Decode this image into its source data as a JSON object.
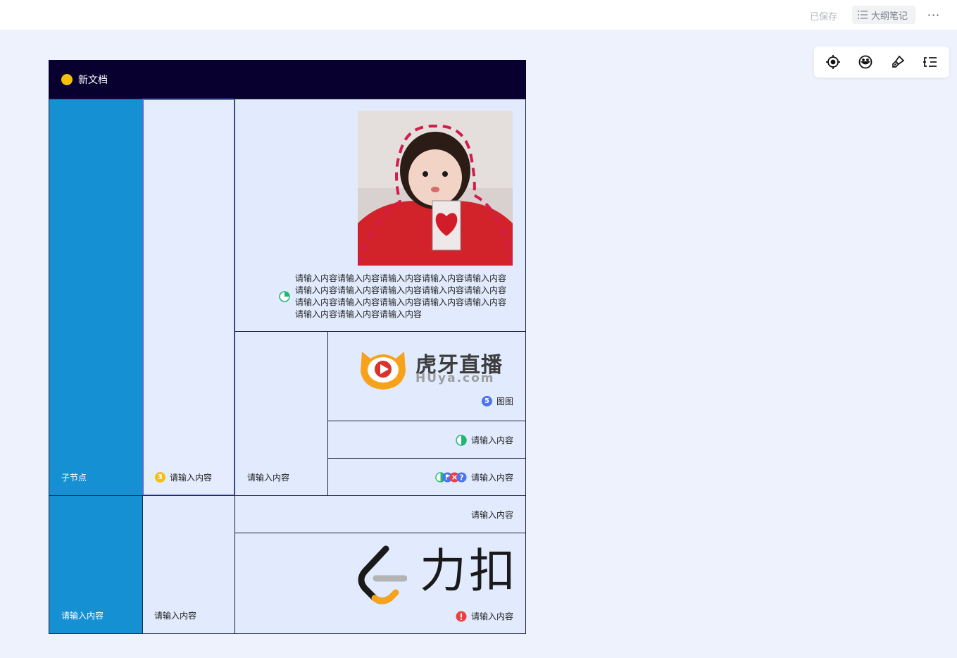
{
  "topbar": {
    "saved_status": "已保存",
    "outline_label": "大纲笔记",
    "more_label": "···"
  },
  "toolbox": {
    "items": [
      "locate-icon",
      "emoji-icon",
      "brush-icon",
      "outline-toggle-icon"
    ]
  },
  "document": {
    "title": "新文档",
    "title_dot_color": "#f4c10a"
  },
  "nodes": {
    "child_node": "子节点",
    "col2_top": "请输入内容",
    "col2_top_badge": "3",
    "image_caption": "请输入内容请输入内容请输入内容请输入内容请输入内容请输入内容请输入内容请输入内容请输入内容请输入内容请输入内容请输入内容请输入内容请输入内容请输入内容请输入内容请输入内容请输入内容",
    "mid_left": "请输入内容",
    "huya_caption": "图图",
    "huya_badge": "5",
    "huya_logo_cn": "虎牙直播",
    "huya_logo_en": "HUya.com",
    "half_circle_node": "请输入内容",
    "multi_icon_node": "请输入内容",
    "bottom_blue": "请输入内容",
    "bottom_col2": "请输入内容",
    "bottom_right_top": "请输入内容",
    "leetcode_node": "请输入内容",
    "leetcode_logo": "力扣"
  },
  "colors": {
    "header_bg": "#08002e",
    "blue_node": "#1590d3",
    "light_node": "#e1ebfd",
    "canvas": "#edf2fd"
  }
}
